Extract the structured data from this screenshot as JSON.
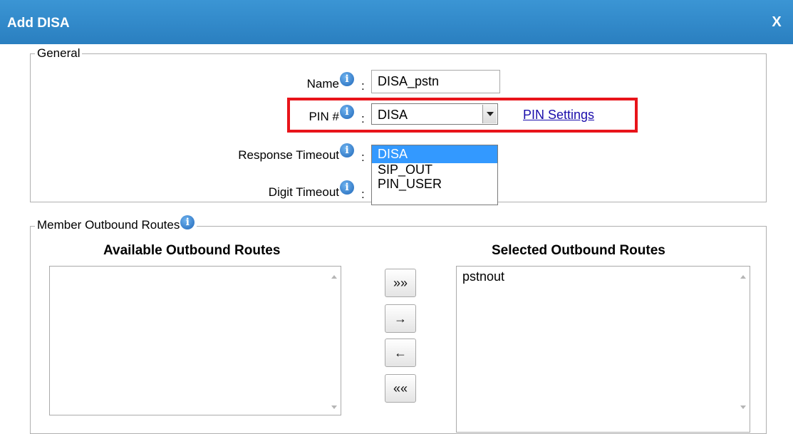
{
  "dialog": {
    "title": "Add DISA",
    "close_label": "X"
  },
  "general": {
    "legend": "General",
    "name_label": "Name",
    "name_value": "DISA_pstn",
    "pin_label": "PIN #",
    "pin_selected": "DISA",
    "pin_options": [
      "DISA",
      "SIP_OUT",
      "PIN_USER"
    ],
    "pin_settings_link": "PIN Settings",
    "response_timeout_label": "Response Timeout",
    "digit_timeout_label": "Digit Timeout",
    "colon": ":"
  },
  "member_routes": {
    "legend": "Member Outbound Routes",
    "available_heading": "Available Outbound Routes",
    "selected_heading": "Selected Outbound Routes",
    "available_items": [],
    "selected_items": [
      "pstnout"
    ],
    "buttons": {
      "add_all": "»»",
      "add": "→",
      "remove": "←",
      "remove_all": "««"
    }
  },
  "icons": {
    "info": "info-icon",
    "colors": {
      "title_bar": "#2a86c9",
      "highlight": "#e8141a",
      "selected_option": "#3399ff"
    }
  }
}
